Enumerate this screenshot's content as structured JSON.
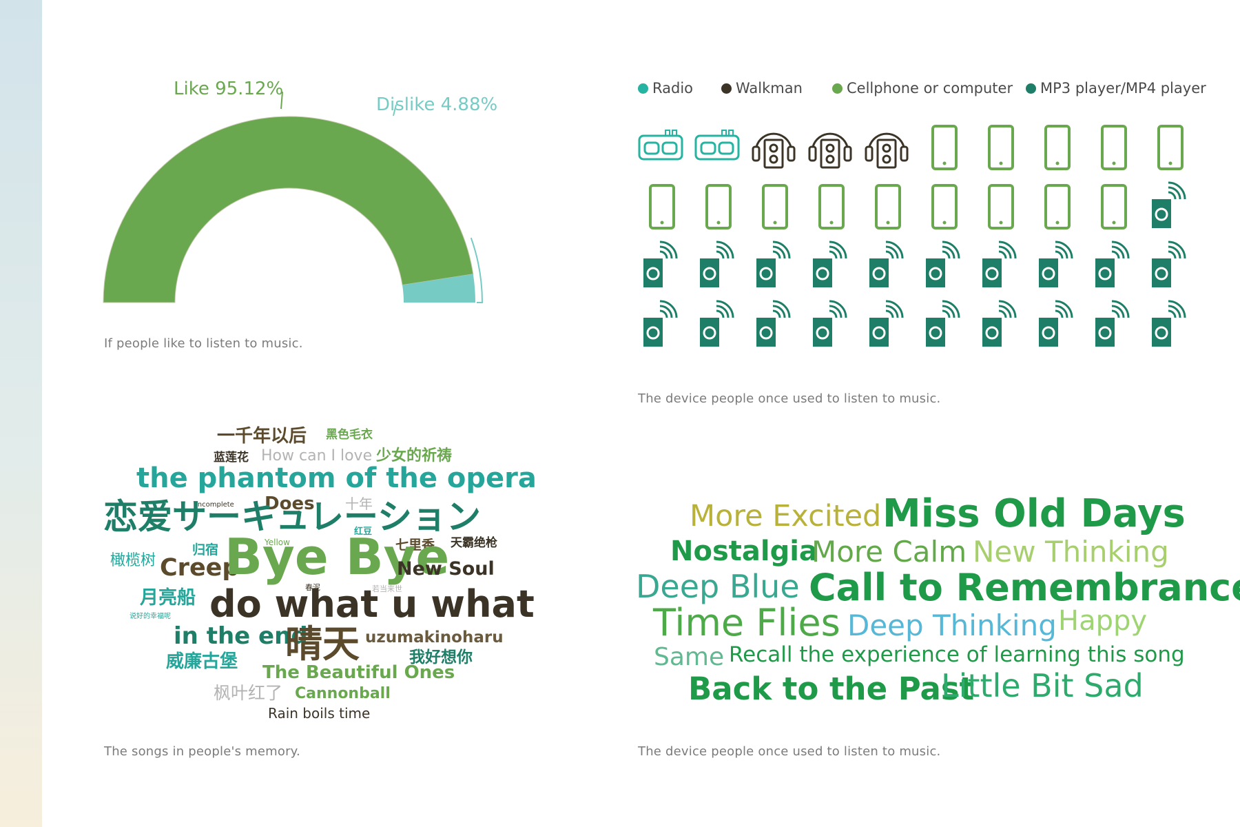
{
  "chart_data": [
    {
      "type": "pie",
      "subtype": "semi-donut",
      "labels": [
        "Like",
        "Dislike"
      ],
      "values": [
        95.12,
        4.88
      ],
      "data_labels": [
        "Like 95.12%",
        "Dislike 4.88%"
      ],
      "colors": [
        "#6aa84f",
        "#76cbc4"
      ],
      "caption": "If people like to listen to music."
    },
    {
      "type": "pictogram",
      "legend": [
        {
          "label": "Radio",
          "color": "#26b3a1",
          "icon": "radio-icon",
          "count": 2
        },
        {
          "label": "Walkman",
          "color": "#3c3527",
          "icon": "walkman-icon",
          "count": 3
        },
        {
          "label": "Cellphone or computer",
          "color": "#6aa84f",
          "icon": "cellphone-icon",
          "count": 14
        },
        {
          "label": "MP3 player/MP4 player",
          "color": "#1e7e67",
          "icon": "mp3-player-icon",
          "count": 21
        }
      ],
      "columns": 10,
      "caption": "The device people once used  to listen to music."
    },
    {
      "type": "wordcloud",
      "words": [
        {
          "text": "一千年以后",
          "color": "#5b4a2c"
        },
        {
          "text": "黑色毛衣",
          "color": "#6aa84f"
        },
        {
          "text": "蓝莲花",
          "color": "#3b3325"
        },
        {
          "text": "How can I love",
          "color": "#b3b3b3"
        },
        {
          "text": "少女的祈祷",
          "color": "#6aa84f"
        },
        {
          "text": "the phantom of the opera",
          "color": "#26a69a"
        },
        {
          "text": "incomplete",
          "color": "#3b3325"
        },
        {
          "text": "Does",
          "color": "#5b4a2c"
        },
        {
          "text": "十年",
          "color": "#b3b3b3"
        },
        {
          "text": "恋爱サーキュレーション",
          "color": "#1e7e67"
        },
        {
          "text": "红豆",
          "color": "#26a69a"
        },
        {
          "text": "Yellow",
          "color": "#6aa84f"
        },
        {
          "text": "七里香",
          "color": "#5b4a2c"
        },
        {
          "text": "天霸绝枪",
          "color": "#3b3325"
        },
        {
          "text": "橄榄树",
          "color": "#26a69a"
        },
        {
          "text": "归宿",
          "color": "#26a69a"
        },
        {
          "text": "Creep",
          "color": "#5b4a2c"
        },
        {
          "text": "Bye Bye",
          "color": "#6aa84f"
        },
        {
          "text": "New Soul",
          "color": "#3b3325"
        },
        {
          "text": "春泥",
          "color": "#3b3325"
        },
        {
          "text": "若当来世",
          "color": "#b3b3b3"
        },
        {
          "text": "月亮船",
          "color": "#26a69a"
        },
        {
          "text": "说好的幸福呢",
          "color": "#26a69a"
        },
        {
          "text": "do what u what",
          "color": "#3b3325"
        },
        {
          "text": "in the end",
          "color": "#1e7e67"
        },
        {
          "text": "晴天",
          "color": "#5b4a2c"
        },
        {
          "text": "uzumakinoharu",
          "color": "#6b5b3e"
        },
        {
          "text": "我好想你",
          "color": "#1e7e67"
        },
        {
          "text": "威廉古堡",
          "color": "#26a69a"
        },
        {
          "text": "The Beautiful Ones",
          "color": "#6aa84f"
        },
        {
          "text": "枫叶红了",
          "color": "#b3b3b3"
        },
        {
          "text": "Cannonball",
          "color": "#6aa84f"
        },
        {
          "text": "Rain boils time",
          "color": "#3b3325"
        }
      ],
      "caption": "The songs in people's memory."
    },
    {
      "type": "wordcloud",
      "words": [
        {
          "text": "More Excited",
          "color": "#b8b13a"
        },
        {
          "text": "Miss Old Days",
          "color": "#1e9a48"
        },
        {
          "text": "Nostalgia",
          "color": "#1e9a48"
        },
        {
          "text": "More Calm",
          "color": "#63a84a"
        },
        {
          "text": "New Thinking",
          "color": "#a8cf6e"
        },
        {
          "text": "Deep Blue",
          "color": "#3aa891"
        },
        {
          "text": "Call to Remembrance",
          "color": "#1e9a48"
        },
        {
          "text": "Time Flies",
          "color": "#4eaa48"
        },
        {
          "text": "Deep Thinking",
          "color": "#56b8d6"
        },
        {
          "text": "Happy",
          "color": "#9ed471"
        },
        {
          "text": "Same",
          "color": "#62b891"
        },
        {
          "text": "Recall the experience of learning this song",
          "color": "#1e9a48"
        },
        {
          "text": "Back to the Past",
          "color": "#1e9a48"
        },
        {
          "text": "Little Bit Sad",
          "color": "#2eaa6c"
        }
      ],
      "caption": "The device people once used  to listen to music."
    }
  ]
}
